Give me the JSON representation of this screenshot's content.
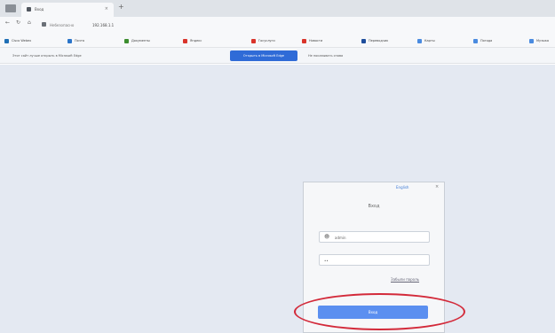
{
  "browser": {
    "tab_title": "Вход",
    "new_tab_symbol": "+",
    "tab_close_symbol": "×",
    "nav": {
      "back": "←",
      "reload": "↻",
      "home": "⌂"
    },
    "url_host": "Небезопасно",
    "url_path": "192.168.1.1"
  },
  "bookmarks": [
    {
      "label": "Cisco Webex",
      "color": "#1f6fb5"
    },
    {
      "label": "Почта",
      "color": "#2a74c9"
    },
    {
      "label": "Документы",
      "color": "#3c8d2f"
    },
    {
      "label": "Яндекс",
      "color": "#d9342b"
    },
    {
      "label": "Госуслуги",
      "color": "#d9342b"
    },
    {
      "label": "Новости",
      "color": "#d9342b"
    },
    {
      "label": "Переводчик",
      "color": "#1f4e9c"
    },
    {
      "label": "Карты",
      "color": "#4a8be0"
    },
    {
      "label": "Погода",
      "color": "#4a8be0"
    },
    {
      "label": "Музыка",
      "color": "#4a8be0"
    }
  ],
  "infobar": {
    "message": "Этот сайт лучше открыть в Microsoft Edge",
    "open_button": "Открыть в Microsoft Edge",
    "other_link": "Не показывать снова"
  },
  "login": {
    "top_link": "English",
    "close_symbol": "×",
    "heading": "Вход",
    "username_value": "admin",
    "password_value": "••",
    "user_icon": "user-icon",
    "forgot_link": "Забыли пароль",
    "submit_label": "Вход"
  },
  "colors": {
    "accent": "#2f6bd7",
    "login_button": "#5b8ff0",
    "highlight_circle": "#d32a3a",
    "page_background": "#e4e9f2"
  }
}
